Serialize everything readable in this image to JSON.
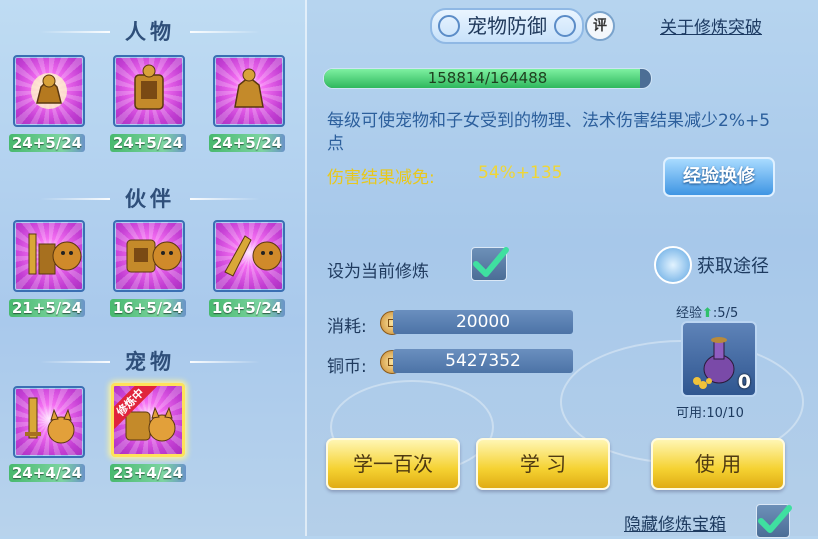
{
  "left": {
    "sections": [
      {
        "title": "人物",
        "items": [
          {
            "name": "person-attack",
            "level": "24+5/24"
          },
          {
            "name": "person-defense",
            "level": "24+5/24"
          },
          {
            "name": "person-magic",
            "level": "24+5/24"
          }
        ]
      },
      {
        "title": "伙伴",
        "items": [
          {
            "name": "partner-attack",
            "level": "21+5/24"
          },
          {
            "name": "partner-defense",
            "level": "16+5/24"
          },
          {
            "name": "partner-magic",
            "level": "16+5/24"
          }
        ]
      },
      {
        "title": "宠物",
        "items": [
          {
            "name": "pet-attack",
            "level": "24+4/24"
          },
          {
            "name": "pet-defense",
            "level": "23+4/24",
            "badge": "修炼中"
          }
        ]
      }
    ]
  },
  "header": {
    "title": "宠物防御",
    "rating": "评",
    "about_link": "关于修炼突破"
  },
  "progress": {
    "text": "158814/164488",
    "current": 158814,
    "max": 164488
  },
  "detail": {
    "description": "每级可使宠物和子女受到的物理、法术伤害结果减少2%+5点",
    "effect_label": "伤害结果减免:",
    "effect_value": "54%+135",
    "exchange_button": "经验换修"
  },
  "settings": {
    "set_current_label": "设为当前修炼",
    "set_current_checked": true,
    "obtain_label": "获取途径"
  },
  "cost": {
    "consume_label": "消耗:",
    "consume_value": "20000",
    "copper_label": "铜币:",
    "copper_value": "5427352"
  },
  "item": {
    "exp_label": "经验",
    "exp_value": ":5/5",
    "count": "0",
    "usable": "可用:10/10"
  },
  "buttons": {
    "learn_hundred": "学一百次",
    "learn": "学 习",
    "use": "使 用"
  },
  "footer": {
    "hide_box_label": "隐藏修炼宝箱",
    "hide_box_checked": true
  },
  "colors": {
    "accent_gold": "#f5d232",
    "accent_green": "#30c06b",
    "effect_yellow": "#e8c81c"
  }
}
